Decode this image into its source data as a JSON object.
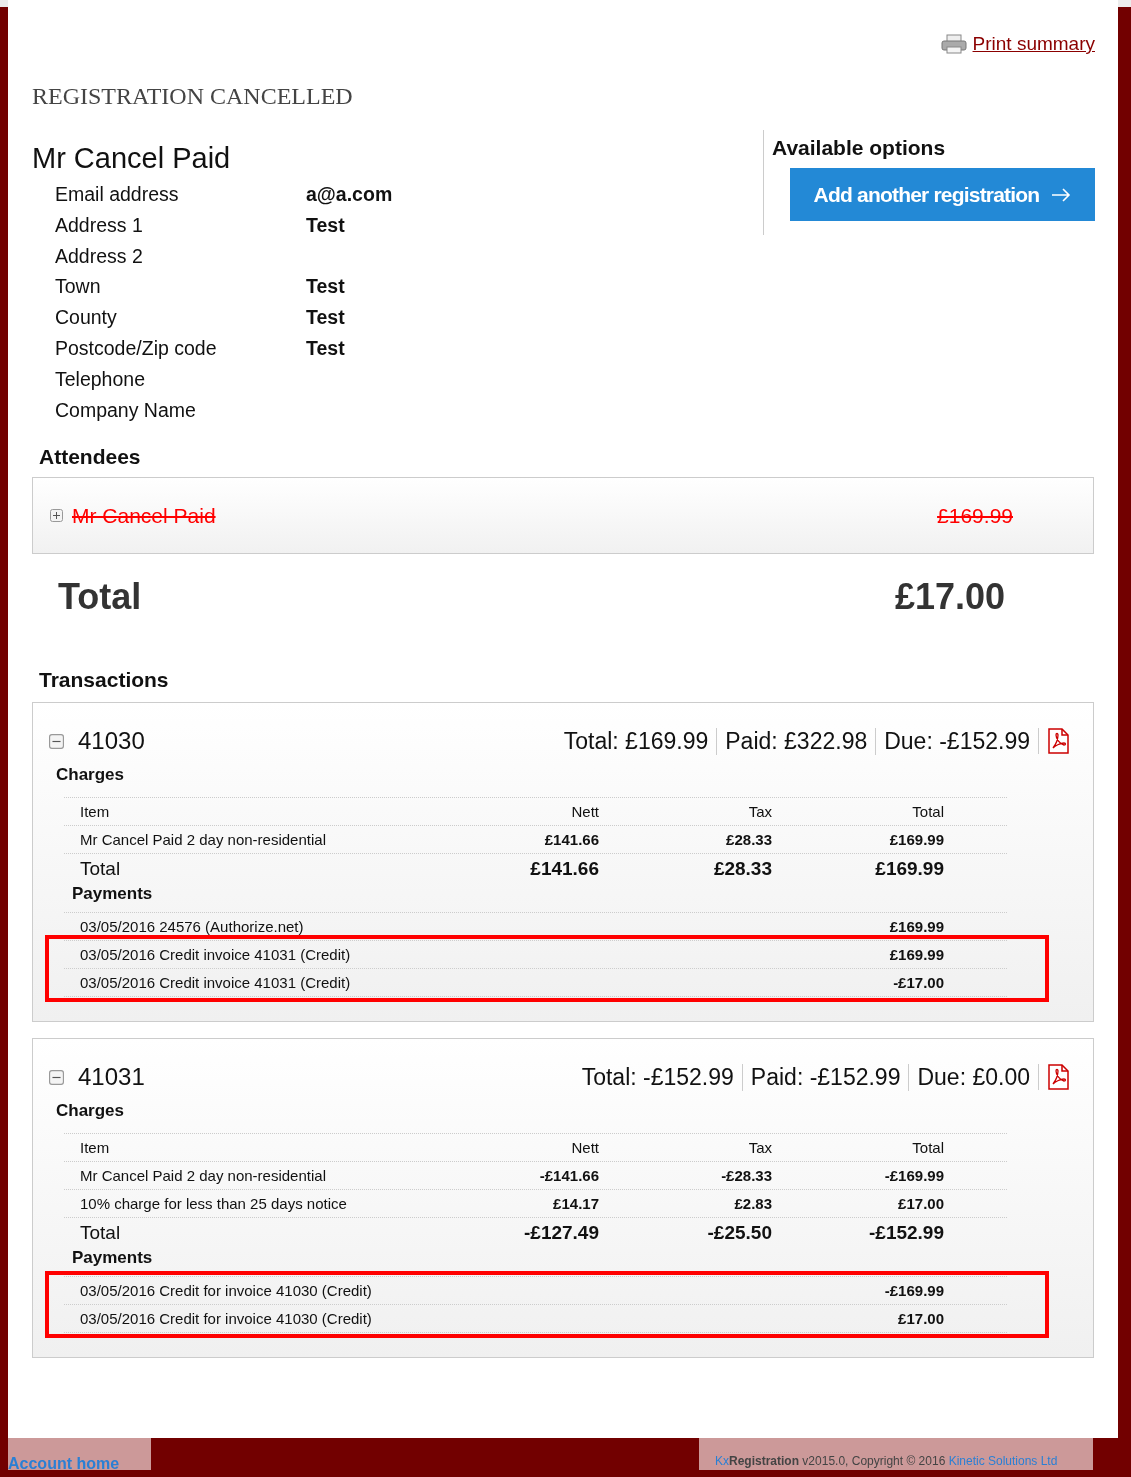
{
  "print_link": "Print summary",
  "status_title": "REGISTRATION CANCELLED",
  "contact": {
    "name": "Mr Cancel Paid",
    "fields": [
      {
        "label": "Email address",
        "value": "a@a.com"
      },
      {
        "label": "Address 1",
        "value": "Test"
      },
      {
        "label": "Address 2"
      },
      {
        "label": "Town",
        "value": "Test"
      },
      {
        "label": "County",
        "value": "Test"
      },
      {
        "label": "Postcode/Zip code",
        "value": "Test"
      },
      {
        "label": "Telephone"
      },
      {
        "label": "Company Name"
      }
    ]
  },
  "options": {
    "title": "Available options",
    "buttons": [
      "Add another registration"
    ]
  },
  "attendees": {
    "title": "Attendees",
    "items": [
      {
        "name": "Mr Cancel Paid",
        "amount": "£169.99",
        "cancelled": true,
        "expanded": false
      }
    ]
  },
  "total": {
    "label": "Total",
    "amount": "£17.00"
  },
  "transactions": {
    "title": "Transactions",
    "invoices": [
      {
        "number": "41030",
        "expanded": true,
        "summary": [
          "Total: £169.99",
          "Paid: £322.98",
          "Due: -£152.99"
        ],
        "charges": {
          "title": "Charges",
          "columns": [
            "Item",
            "Nett",
            "Tax",
            "Total"
          ],
          "rows": [
            [
              "Mr Cancel Paid 2 day non-residential",
              "£141.66",
              "£28.33",
              "£169.99"
            ]
          ],
          "total": [
            "Total",
            "£141.66",
            "£28.33",
            "£169.99"
          ]
        },
        "payments": {
          "title": "Payments",
          "rows": [
            {
              "description": "03/05/2016 24576 (Authorize.net)",
              "amount": "£169.99",
              "highlighted": false
            },
            {
              "description": "03/05/2016 Credit invoice 41031 (Credit)",
              "amount": "£169.99",
              "highlighted": true
            },
            {
              "description": "03/05/2016 Credit invoice 41031 (Credit)",
              "amount": "-£17.00",
              "highlighted": true
            }
          ]
        }
      },
      {
        "number": "41031",
        "expanded": true,
        "summary": [
          "Total: -£152.99",
          "Paid: -£152.99",
          "Due: £0.00"
        ],
        "charges": {
          "title": "Charges",
          "columns": [
            "Item",
            "Nett",
            "Tax",
            "Total"
          ],
          "rows": [
            [
              "Mr Cancel Paid 2 day non-residential",
              "-£141.66",
              "-£28.33",
              "-£169.99"
            ],
            [
              " 10% charge for less than 25 days notice",
              "£14.17",
              "£2.83",
              "£17.00"
            ]
          ],
          "total": [
            "Total",
            "-£127.49",
            "-£25.50",
            "-£152.99"
          ]
        },
        "payments": {
          "title": "Payments",
          "rows": [
            {
              "description": "03/05/2016 Credit for invoice 41030 (Credit)",
              "amount": "-£169.99",
              "highlighted": true
            },
            {
              "description": "03/05/2016 Credit for invoice 41030 (Credit)",
              "amount": "£17.00",
              "highlighted": true
            }
          ]
        }
      }
    ]
  },
  "footer": {
    "link": "Account home",
    "brand_prefix": "Kx",
    "brand": "Registration",
    "credit": "v2015.0, Copyright © 2016",
    "company": "Kinetic Solutions Ltd"
  }
}
